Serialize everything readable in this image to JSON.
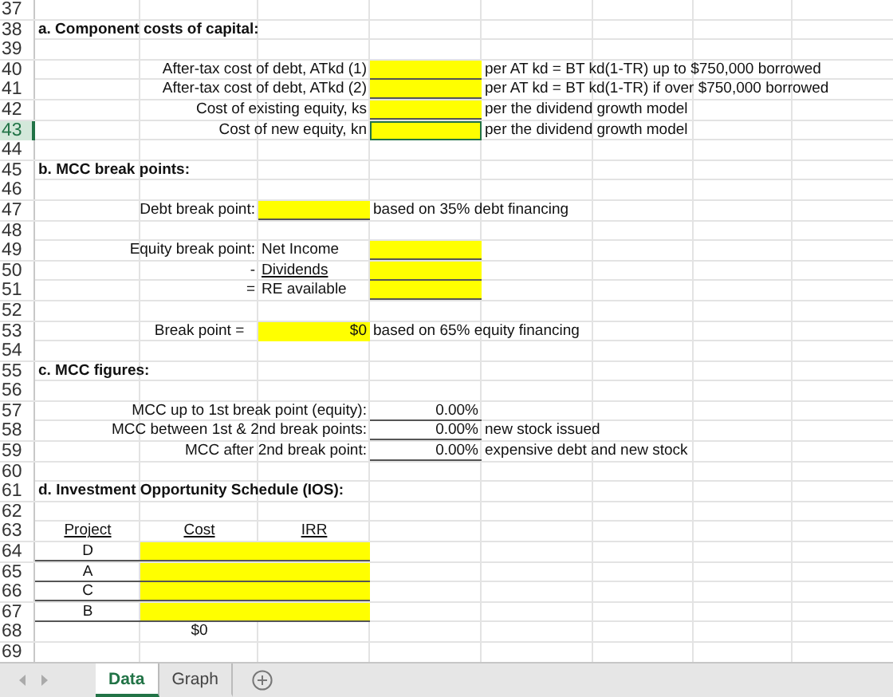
{
  "rows": [
    {
      "number": "37",
      "selected": false,
      "kind": "blank"
    },
    {
      "number": "38",
      "selected": false,
      "kind": "heading",
      "title": {
        "text": "a.  Component costs of capital:"
      }
    },
    {
      "number": "39",
      "selected": false,
      "kind": "blank"
    },
    {
      "number": "40",
      "selected": false,
      "kind": "cost",
      "label": {
        "text": "After-tax cost of debt, ATkd (1)"
      },
      "input": {
        "highlighted": true,
        "bordered": true,
        "cursor": false
      },
      "note": {
        "text": "per AT kd = BT kd(1-TR) up to $750,000 borrowed"
      }
    },
    {
      "number": "41",
      "selected": false,
      "kind": "cost",
      "label": {
        "text": "After-tax cost of debt, ATkd (2)"
      },
      "input": {
        "highlighted": true,
        "bordered": true,
        "cursor": false
      },
      "note": {
        "text": "per AT kd = BT kd(1-TR) if over $750,000 borrowed"
      }
    },
    {
      "number": "42",
      "selected": false,
      "kind": "cost",
      "label": {
        "text": "Cost of existing equity, ks"
      },
      "input": {
        "highlighted": true,
        "bordered": true,
        "cursor": false
      },
      "note": {
        "text": "per the dividend growth model"
      }
    },
    {
      "number": "43",
      "selected": true,
      "kind": "cost",
      "label": {
        "text": "Cost of new equity, kn"
      },
      "input": {
        "highlighted": true,
        "bordered": false,
        "cursor": true
      },
      "note": {
        "text": "per the dividend growth model"
      }
    },
    {
      "number": "44",
      "selected": false,
      "kind": "blank"
    },
    {
      "number": "45",
      "selected": false,
      "kind": "heading",
      "title": {
        "text": "b.  MCC break points:"
      }
    },
    {
      "number": "46",
      "selected": false,
      "kind": "blank"
    },
    {
      "number": "47",
      "selected": false,
      "kind": "debt_break",
      "label": {
        "text": "Debt break point:"
      },
      "input": {
        "highlighted": true,
        "bordered": true
      },
      "note": {
        "text": "based on 35% debt financing"
      }
    },
    {
      "number": "48",
      "selected": false,
      "kind": "blank"
    },
    {
      "number": "49",
      "selected": false,
      "kind": "equity",
      "label": {
        "text": "Equity break point:"
      },
      "item": {
        "text": "Net Income",
        "underlined": false
      },
      "input": {
        "highlighted": true,
        "bordered": true
      }
    },
    {
      "number": "50",
      "selected": false,
      "kind": "equity",
      "label": {
        "text": "-"
      },
      "item": {
        "text": "Dividends",
        "underlined": true
      },
      "input": {
        "highlighted": true,
        "bordered": true
      }
    },
    {
      "number": "51",
      "selected": false,
      "kind": "equity",
      "label": {
        "text": "="
      },
      "item": {
        "text": "RE available",
        "underlined": false
      },
      "input": {
        "highlighted": true,
        "bordered": true
      }
    },
    {
      "number": "52",
      "selected": false,
      "kind": "blank"
    },
    {
      "number": "53",
      "selected": false,
      "kind": "break_total",
      "label": {
        "text": "Break point ="
      },
      "input": {
        "text": "$0",
        "highlighted": true
      },
      "note": {
        "text": "based on 65% equity financing"
      }
    },
    {
      "number": "54",
      "selected": false,
      "kind": "blank"
    },
    {
      "number": "55",
      "selected": false,
      "kind": "heading",
      "title": {
        "text": "c.  MCC figures:"
      }
    },
    {
      "number": "56",
      "selected": false,
      "kind": "blank"
    },
    {
      "number": "57",
      "selected": false,
      "kind": "mcc",
      "label": {
        "text": "MCC up to 1st break point (equity):"
      },
      "value": {
        "text": "0.00%",
        "bordered": true
      }
    },
    {
      "number": "58",
      "selected": false,
      "kind": "mcc",
      "label": {
        "text": "MCC between 1st & 2nd break points:"
      },
      "value": {
        "text": "0.00%",
        "bordered": true
      },
      "note": {
        "text": "new stock issued"
      }
    },
    {
      "number": "59",
      "selected": false,
      "kind": "mcc",
      "label": {
        "text": "MCC after 2nd break point:"
      },
      "value": {
        "text": "0.00%",
        "bordered": true
      },
      "note": {
        "text": "expensive debt and new stock"
      }
    },
    {
      "number": "60",
      "selected": false,
      "kind": "blank"
    },
    {
      "number": "61",
      "selected": false,
      "kind": "heading",
      "title": {
        "text": "d.  Investment Opportunity Schedule (IOS):"
      }
    },
    {
      "number": "62",
      "selected": false,
      "kind": "blank"
    },
    {
      "number": "63",
      "selected": false,
      "kind": "ios_header",
      "project": {
        "text": "Project",
        "underlined": true
      },
      "cost": {
        "text": "Cost",
        "underlined": true
      },
      "irr": {
        "text": "IRR",
        "underlined": true
      }
    },
    {
      "number": "64",
      "selected": false,
      "kind": "ios_row",
      "project": {
        "text": "D",
        "bordered": true
      },
      "input": {
        "highlighted": true,
        "bordered": true
      }
    },
    {
      "number": "65",
      "selected": false,
      "kind": "ios_row",
      "project": {
        "text": "A",
        "bordered": true
      },
      "input": {
        "highlighted": true,
        "bordered": true
      }
    },
    {
      "number": "66",
      "selected": false,
      "kind": "ios_row",
      "project": {
        "text": "C",
        "bordered": true
      },
      "input": {
        "highlighted": true,
        "bordered": true
      }
    },
    {
      "number": "67",
      "selected": false,
      "kind": "ios_row",
      "project": {
        "text": "B",
        "bordered": true
      },
      "input": {
        "highlighted": true,
        "bordered": true
      }
    },
    {
      "number": "68",
      "selected": false,
      "kind": "total",
      "cost": {
        "text": "$0"
      }
    },
    {
      "number": "69",
      "selected": false,
      "kind": "blank"
    }
  ],
  "sheet_tabs": [
    {
      "label": "Data",
      "selected": true
    },
    {
      "label": "Graph",
      "selected": false
    }
  ]
}
